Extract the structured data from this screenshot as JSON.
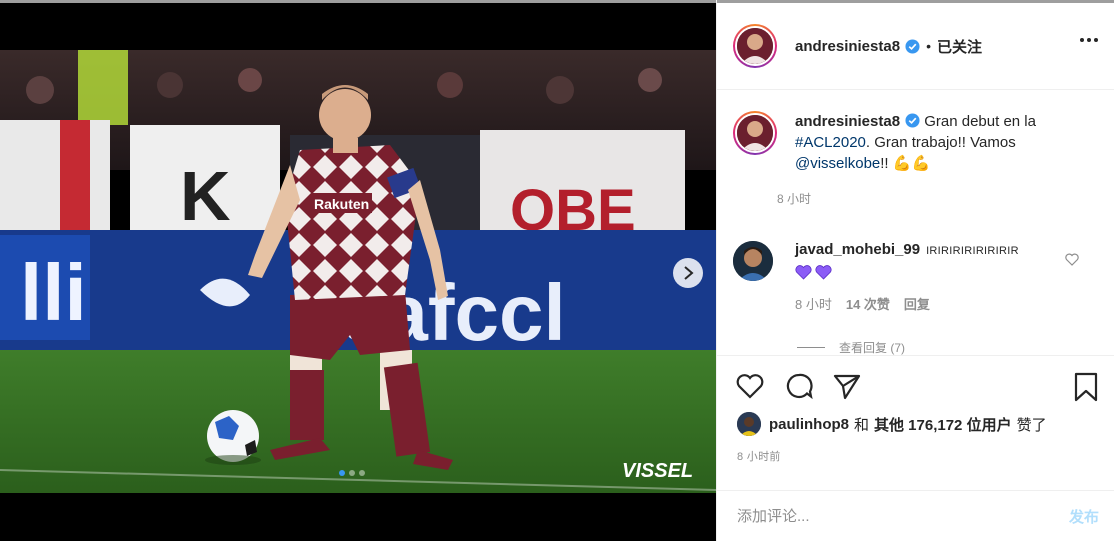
{
  "header": {
    "username": "andresiniesta8",
    "separator": "•",
    "follow_label": "已关注"
  },
  "caption": {
    "username": "andresiniesta8",
    "text_part1": "Gran debut en la",
    "hashtag": "#ACL2020",
    "text_part2": ". Gran trabajo!! Vamos",
    "mention": "@visselkobe",
    "text_part3": "!!",
    "emoji": "💪💪",
    "time": "8 小时"
  },
  "comment": {
    "username": "javad_mohebi_99",
    "text": "IRIRIRIRIRIRIRIR",
    "emoji": "💜💜",
    "time": "8 小时",
    "likes": "14 次赞",
    "reply_label": "回复",
    "view_replies": "查看回复 (7)"
  },
  "actions": {
    "liked_by_user": "paulinhop8",
    "and_label": "和",
    "others_label": "其他 176,172 位用户",
    "liked_suffix": "赞了",
    "post_time": "8 小时前"
  },
  "add_comment": {
    "placeholder": "添加评论...",
    "post_label": "发布"
  },
  "media": {
    "watermark": "VISSEL",
    "jersey_sponsor": "Rakuten",
    "banner_text": "heafccl",
    "banner_letters": "K",
    "slide_count": 3,
    "active_slide": 1
  },
  "colors": {
    "link": "#00376b",
    "verified": "#3897f0",
    "post_button_disabled": "#b2dffc",
    "heart_purple": "#8b5cf6"
  }
}
